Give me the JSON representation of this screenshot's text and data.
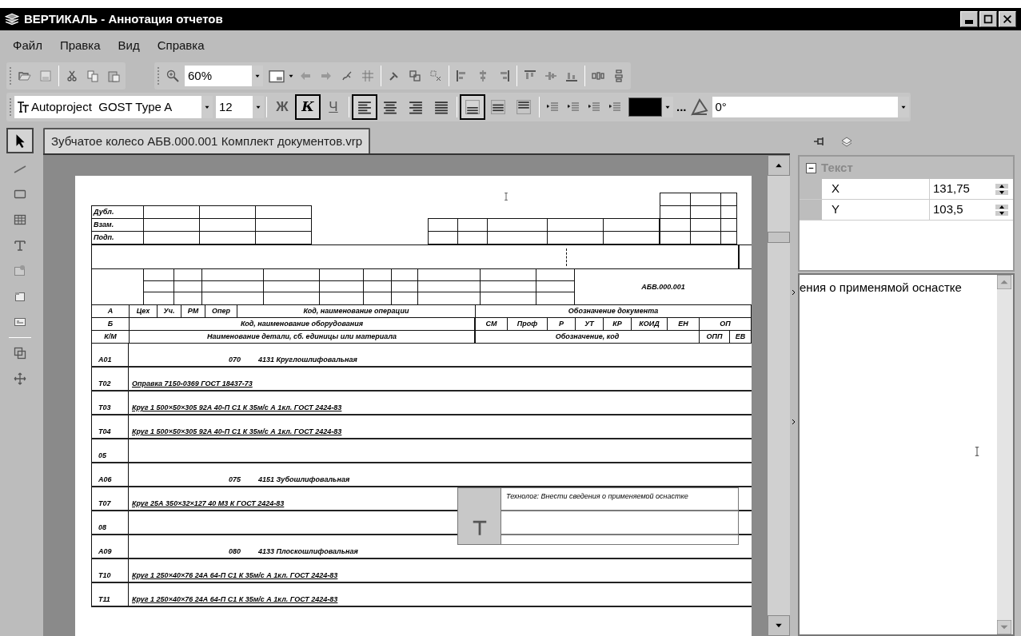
{
  "window": {
    "title": "ВЕРТИКАЛЬ - Аннотация отчетов"
  },
  "menu": [
    {
      "label": "Файл"
    },
    {
      "label": "Правка"
    },
    {
      "label": "Вид"
    },
    {
      "label": "Справка"
    }
  ],
  "toolbar": {
    "zoom": "60%"
  },
  "format_bar": {
    "font": "Autoproject  GOST Type A",
    "size": "12",
    "styles": [
      {
        "kind": "bold",
        "label": "Ж",
        "on": false
      },
      {
        "kind": "italic",
        "label": "К",
        "on": true
      },
      {
        "kind": "underline",
        "label": "Ч",
        "on": false
      }
    ],
    "align": [
      {
        "kind": "left",
        "selected": true
      },
      {
        "kind": "center",
        "selected": false
      },
      {
        "kind": "right",
        "selected": false
      },
      {
        "kind": "justify",
        "selected": false
      }
    ],
    "valign": [
      {
        "kind": "bottom",
        "selected": true
      },
      {
        "kind": "middle",
        "selected": false
      },
      {
        "kind": "top",
        "selected": false
      }
    ],
    "color": "#000000",
    "more": "...",
    "angle": "0°"
  },
  "tab": {
    "label": "Зубчатое колесо АБВ.000.001 Комплект документов.vrp",
    "selected": true
  },
  "form": {
    "stamp_rows": [
      "Дубл.",
      "Взам.",
      "Подп."
    ],
    "doc_code": "АБВ.000.001",
    "header_rows": [
      [
        "А",
        "Цех",
        "Уч.",
        "РМ",
        "Опер",
        "Код, наименование операции",
        "Обозначение документа"
      ],
      [
        "Б",
        "Код, наименование оборудования",
        "СМ",
        "Проф",
        "Р",
        "УТ",
        "КР",
        "КОИД",
        "ЕН",
        "ОП"
      ],
      [
        "К/М",
        "Наименование детали, сб. единицы или материала",
        "Обозначение, код",
        "ОПП",
        "ЕВ"
      ]
    ],
    "rows": [
      {
        "kind": "operation",
        "code": "А01",
        "number": "070",
        "name": "4131 Круглошлифовальная"
      },
      {
        "kind": "tool",
        "code": "Т02",
        "text": "Оправка 7150-0369 ГОСТ 18437-73"
      },
      {
        "kind": "tool",
        "code": "Т03",
        "text": "Круг 1 500×50×305 92А 40-П С1 К 35м/с А 1кл. ГОСТ 2424-83"
      },
      {
        "kind": "tool",
        "code": "Т04",
        "text": "Круг 1 500×50×305 92А 40-П С1 К 35м/с А 1кл. ГОСТ 2424-83"
      },
      {
        "kind": "blank",
        "code": "05"
      },
      {
        "kind": "operation",
        "code": "А06",
        "number": "075",
        "name": "4151 Зубошлифовальная"
      },
      {
        "kind": "tool",
        "code": "Т07",
        "text": "Круг 25А 350×32×127 40 М3 К ГОСТ 2424-83"
      },
      {
        "kind": "blank",
        "code": "08"
      },
      {
        "kind": "operation",
        "code": "А09",
        "number": "080",
        "name": "4133 Плоскошлифовальная"
      },
      {
        "kind": "tool",
        "code": "Т10",
        "text": "Круг 1 250×40×76 24А 64-П С1 К 35м/с А 1кл. ГОСТ 2424-83"
      },
      {
        "kind": "tool",
        "code": "Т11",
        "text": "Круг 1 250×40×76 24А 64-П С1 К 35м/с А 1кл. ГОСТ 2424-83"
      }
    ],
    "annotation": {
      "text": "Технолог: Внести сведения о применяемой оснастке"
    }
  },
  "properties": {
    "group": {
      "label": "Текст",
      "expanded": true
    },
    "rows": [
      {
        "name": "X",
        "value": "131,75"
      },
      {
        "name": "Y",
        "value": "103,5"
      }
    ]
  },
  "note_editor": {
    "text": "ения о применямой оснастке"
  }
}
